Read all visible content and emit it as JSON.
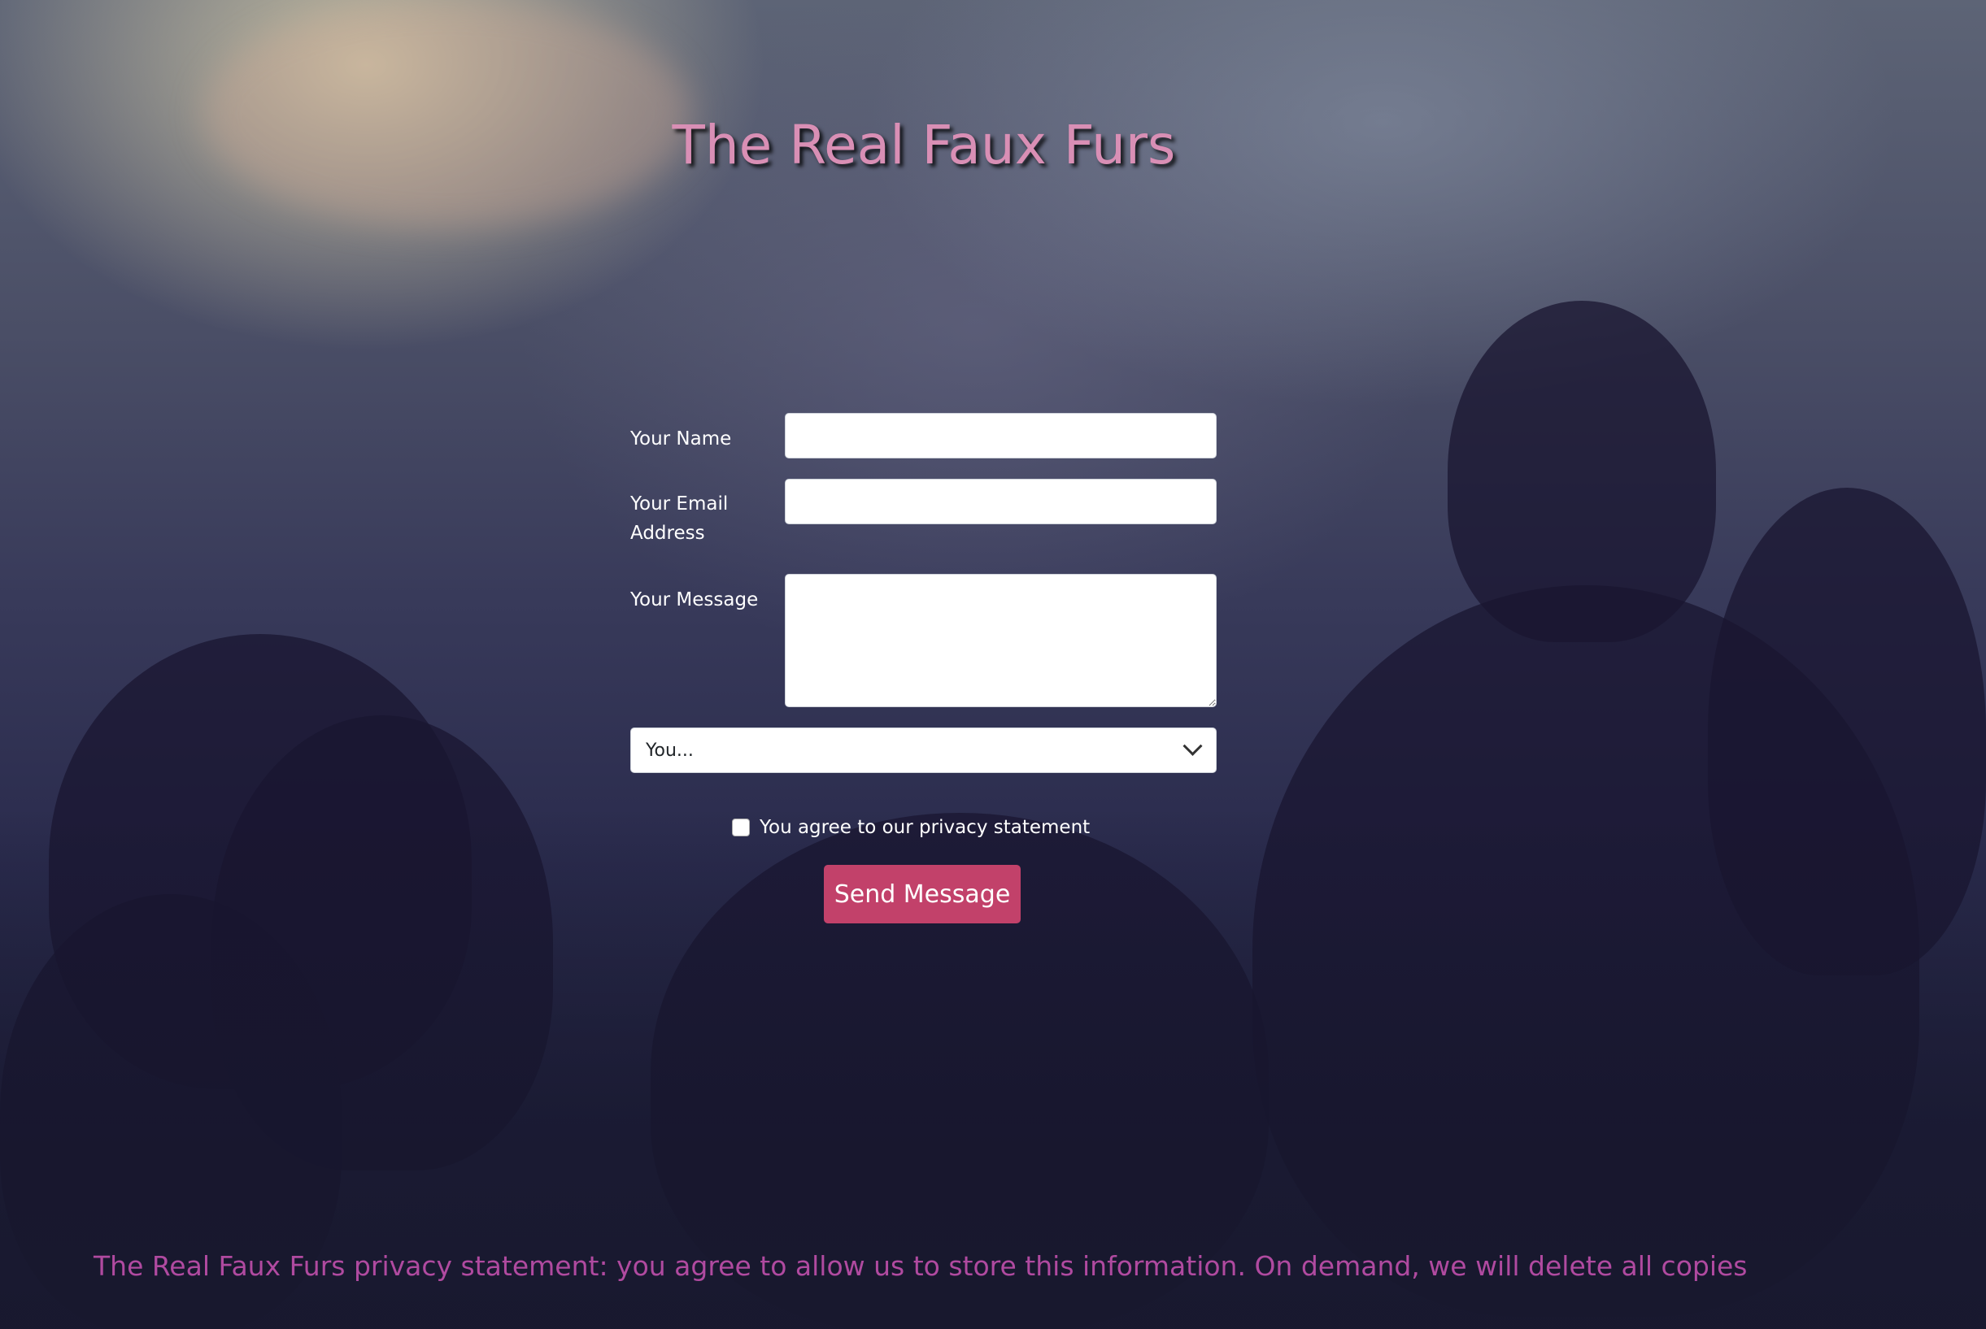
{
  "page": {
    "title": "The Real Faux Furs"
  },
  "form": {
    "name_label": "Your Name",
    "name_value": "",
    "email_label": "Your Email Address",
    "email_value": "",
    "message_label": "Your Message",
    "message_value": "",
    "select_value": "You...",
    "privacy_checked": false,
    "privacy_label": "You agree to our privacy statement",
    "send_label": "Send Message"
  },
  "footer": {
    "text": "The Real Faux Furs privacy statement: you agree to allow us to store this information. On demand, we will delete all copies"
  },
  "colors": {
    "title": "#d98fb5",
    "button": "#c2416a",
    "footer": "#b04aa0"
  }
}
